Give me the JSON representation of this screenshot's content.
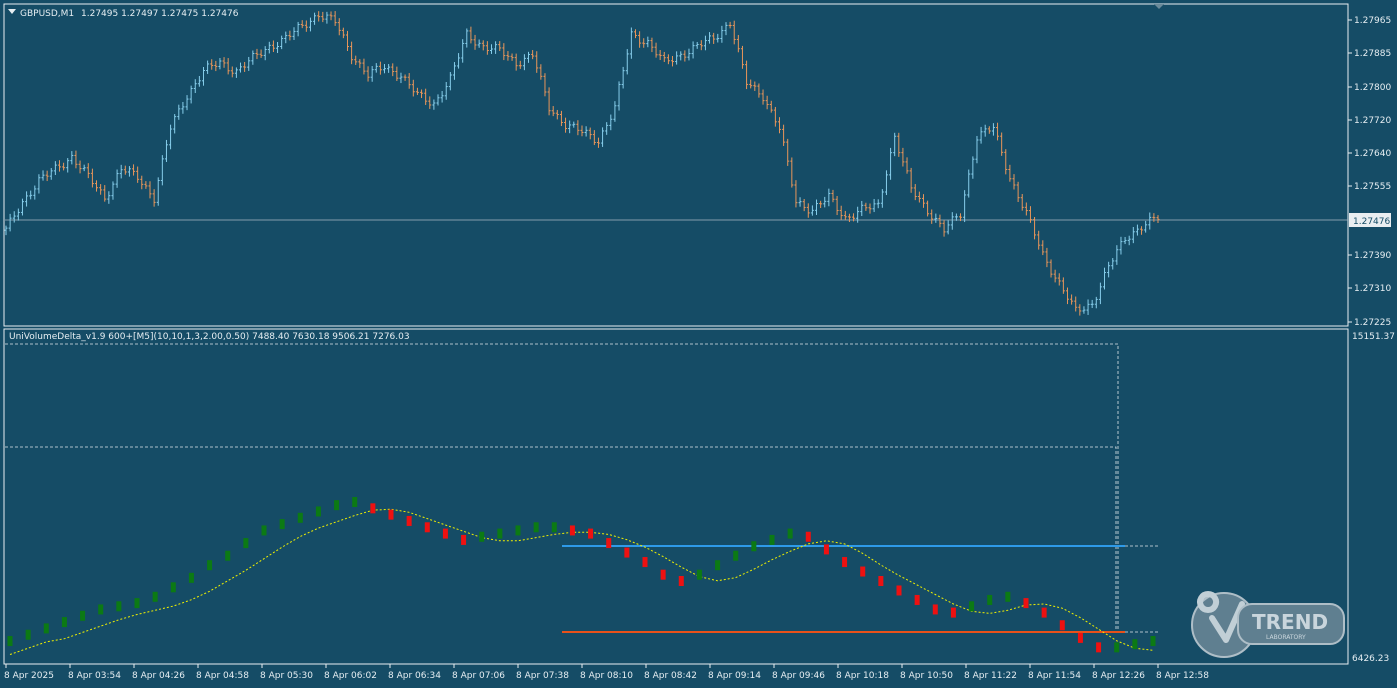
{
  "colors": {
    "background": "#154c66",
    "frame": "#e9eef1",
    "bull_bar": "#87ceeb",
    "bear_bar": "#e9965a",
    "price_line": "#a9b9c4",
    "delta_up": "#0c7a14",
    "delta_down": "#ee1111",
    "signal": "#f0f000",
    "level_high": "#2e9ae8",
    "level_low": "#e8511a",
    "guide": "#dfe6ea"
  },
  "header": {
    "symbol_menu_icon": "triangle-down-icon",
    "symbol": "GBPUSD,M1",
    "quote": "1.27495 1.27497 1.27475 1.27476"
  },
  "indicator": {
    "title": "UniVolumeDelta_v1.9 600+[M5](10,10,1,3,2.00,0.50) 7488.40 7630.18 9506.21 7276.03"
  },
  "price_axis": {
    "ticks": [
      "1.27965",
      "1.27885",
      "1.27800",
      "1.27720",
      "1.27640",
      "1.27555",
      "1.27390",
      "1.27310",
      "1.27225"
    ],
    "current_price": "1.27476"
  },
  "indicator_axis": {
    "max": "15151.37",
    "min": "6426.23"
  },
  "time_axis": {
    "ticks": [
      "8 Apr 2025",
      "8 Apr 03:54",
      "8 Apr 04:26",
      "8 Apr 04:58",
      "8 Apr 05:30",
      "8 Apr 06:02",
      "8 Apr 06:34",
      "8 Apr 07:06",
      "8 Apr 07:38",
      "8 Apr 08:10",
      "8 Apr 08:42",
      "8 Apr 09:14",
      "8 Apr 09:46",
      "8 Apr 10:18",
      "8 Apr 10:50",
      "8 Apr 11:22",
      "8 Apr 11:54",
      "8 Apr 12:26",
      "8 Apr 12:58"
    ]
  },
  "logo": {
    "name": "TREND",
    "sub": "LABORATORY"
  },
  "chart_data": [
    {
      "type": "line",
      "title": "",
      "series": [
        {
          "values": [
            1.2745,
            1.2752,
            1.2757,
            1.276,
            1.2763,
            1.2758,
            1.2753,
            1.276,
            1.2758,
            1.2753,
            1.277,
            1.2778,
            1.2784,
            1.2786,
            1.2784,
            1.2787,
            1.279,
            1.2792,
            1.2795,
            1.2798,
            1.2796,
            1.2788,
            1.2783,
            1.2785,
            1.2783,
            1.2778,
            1.2776,
            1.2782,
            1.2793,
            1.279,
            1.2789,
            1.2786,
            1.2788,
            1.2775,
            1.2771,
            1.2769,
            1.2767,
            1.2775,
            1.2793,
            1.2791,
            1.2786,
            1.2788,
            1.279,
            1.2792,
            1.2796,
            1.2781,
            1.2778,
            1.277,
            1.2752,
            1.275,
            1.2753,
            1.2748,
            1.275,
            1.2751,
            1.2768,
            1.2755,
            1.275,
            1.2745,
            1.2749,
            1.2768,
            1.277,
            1.2758,
            1.2749,
            1.2739,
            1.2732,
            1.2725,
            1.2727,
            1.2736,
            1.2743,
            1.2746,
            1.2748
          ]
        }
      ],
      "ylim": [
        1.27225,
        1.27965
      ],
      "grid": false
    },
    {
      "type": "line",
      "title": "",
      "series": [
        {
          "values": [
            0.06,
            0.08,
            0.1,
            0.12,
            0.14,
            0.16,
            0.17,
            0.18,
            0.2,
            0.23,
            0.26,
            0.3,
            0.33,
            0.37,
            0.41,
            0.43,
            0.45,
            0.47,
            0.49,
            0.5,
            0.48,
            0.46,
            0.44,
            0.42,
            0.4,
            0.38,
            0.39,
            0.4,
            0.41,
            0.42,
            0.42,
            0.41,
            0.4,
            0.37,
            0.34,
            0.31,
            0.27,
            0.25,
            0.27,
            0.3,
            0.33,
            0.36,
            0.38,
            0.4,
            0.39,
            0.35,
            0.31,
            0.28,
            0.25,
            0.22,
            0.19,
            0.16,
            0.15,
            0.17,
            0.19,
            0.2,
            0.18,
            0.15,
            0.11,
            0.07,
            0.04,
            0.04,
            0.05,
            0.06
          ]
        }
      ],
      "levels": {
        "high": 0.43,
        "low": 0.04
      },
      "grid": false
    }
  ]
}
